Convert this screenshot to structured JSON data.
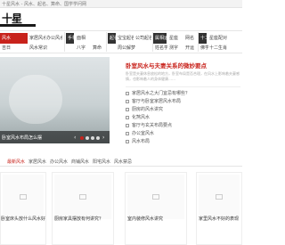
{
  "topbar": {
    "text": "十星风水 - 风水、起名、算命、国学学问网"
  },
  "logo": {
    "text": "十星"
  },
  "nav": {
    "row1": [
      "风水",
      "家居风水",
      "办公风水",
      "手相",
      "面相",
      "起名",
      "宝宝起名",
      "公司起名",
      "个人起名",
      "属相运势",
      "星座",
      "网名",
      "十二星座",
      "星座配对"
    ],
    "row2": [
      "吉日",
      "风水常识",
      "八字",
      "算命",
      "周公解梦",
      "姓名学",
      "测字",
      "开运",
      "佛学",
      "生肖",
      "十二生肖",
      "星座运势"
    ]
  },
  "hero": {
    "caption": "卧室风水布局怎么摆"
  },
  "news": {
    "title": "卧室风水与夫妻关系的微妙要点",
    "summary": "卧室是夫妻休息放松的地方，卧室布局是否合理，在风水上影响着夫妻感情，也影响着人的身体健康……",
    "items": [
      "家居风水之大门宜忌有哪些？",
      "客厅与卧室家居风水布局",
      "厨房的风水讲究",
      "化煞风水",
      "客厅与玄关布局要点",
      "办公室风水",
      "风水布局",
      "阳宅布局"
    ]
  },
  "tabs": [
    "最新风水",
    "家居风水",
    "办公风水",
    "商铺风水",
    "阳宅风水",
    "风水禁忌"
  ],
  "cards": [
    {
      "title": "卧室床头放什么风水好",
      "sub": "",
      "tag": ""
    },
    {
      "title": "厨房家具摆放有何讲究？",
      "sub": "",
      "tag": ""
    },
    {
      "title": "室内装修风水讲究",
      "sub": "",
      "tag": ""
    },
    {
      "title": "家里风水不好的表现",
      "sub": "",
      "tag": ""
    }
  ],
  "colors": {
    "accent": "#c8231c",
    "dark": "#333333"
  }
}
